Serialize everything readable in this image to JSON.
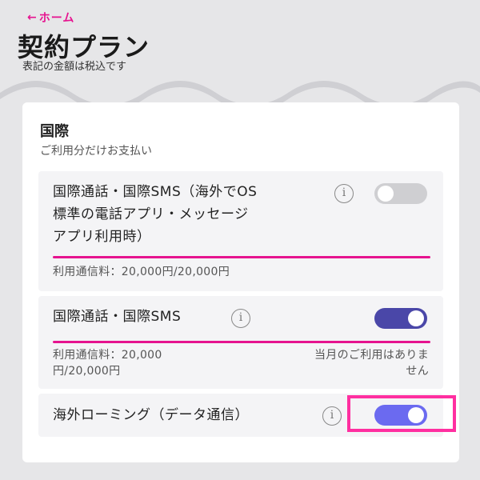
{
  "header": {
    "back_label": "ホーム",
    "title": "契約プラン",
    "subtitle": "表記の金額は税込です"
  },
  "section": {
    "title": "国際",
    "subtitle": "ご利用分だけお支払い"
  },
  "items": [
    {
      "label_lines": [
        "国際通話・国際SMS（海外でOS",
        "標準の電話アプリ・メッセージ",
        "アプリ利用時）"
      ],
      "info_symbol": "i",
      "toggle_on": false,
      "usage": "利用通信料：20,000円/20,000円",
      "usage_progress": 1.0
    },
    {
      "label": "国際通話・国際SMS",
      "info_symbol": "i",
      "toggle_on": true,
      "usage_lines": [
        "利用通信料：20,000",
        "円/20,000円"
      ],
      "note_lines": [
        "当月のご利用はありま",
        "せん"
      ],
      "usage_progress": 1.0
    },
    {
      "label": "海外ローミング（データ通信）",
      "info_symbol": "i",
      "toggle_on": true
    }
  ],
  "colors": {
    "accent": "#e6138f",
    "toggle_on": "#4a47a8",
    "toggle_on_light": "#6b6af0",
    "toggle_off": "#cfcfd2",
    "highlight": "#ff2fa0"
  }
}
